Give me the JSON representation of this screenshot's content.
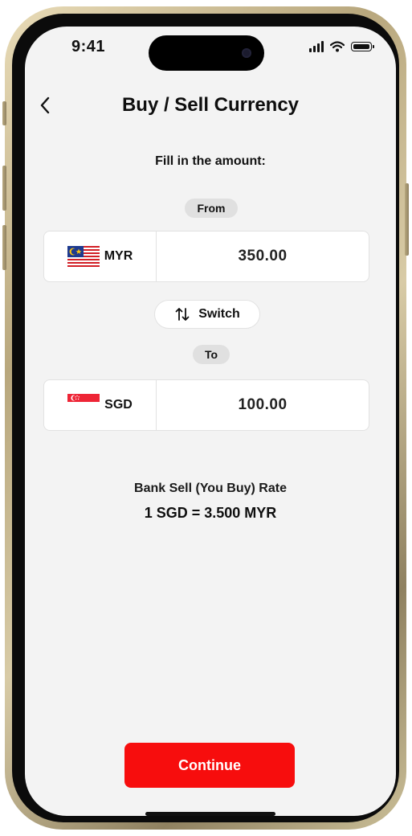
{
  "status_bar": {
    "time": "9:41"
  },
  "header": {
    "title": "Buy / Sell Currency"
  },
  "form": {
    "instruction": "Fill in the amount:",
    "from_label": "From",
    "to_label": "To",
    "from": {
      "currency": "MYR",
      "amount": "350.00",
      "flag": "malaysia-flag"
    },
    "to": {
      "currency": "SGD",
      "amount": "100.00",
      "flag": "singapore-flag"
    },
    "switch_label": "Switch"
  },
  "rate": {
    "label": "Bank Sell (You Buy) Rate",
    "value": "1 SGD = 3.500 MYR"
  },
  "footer": {
    "continue_label": "Continue"
  },
  "colors": {
    "accent": "#f70d0d",
    "background": "#f3f3f3",
    "pill": "#e0e0e0"
  }
}
